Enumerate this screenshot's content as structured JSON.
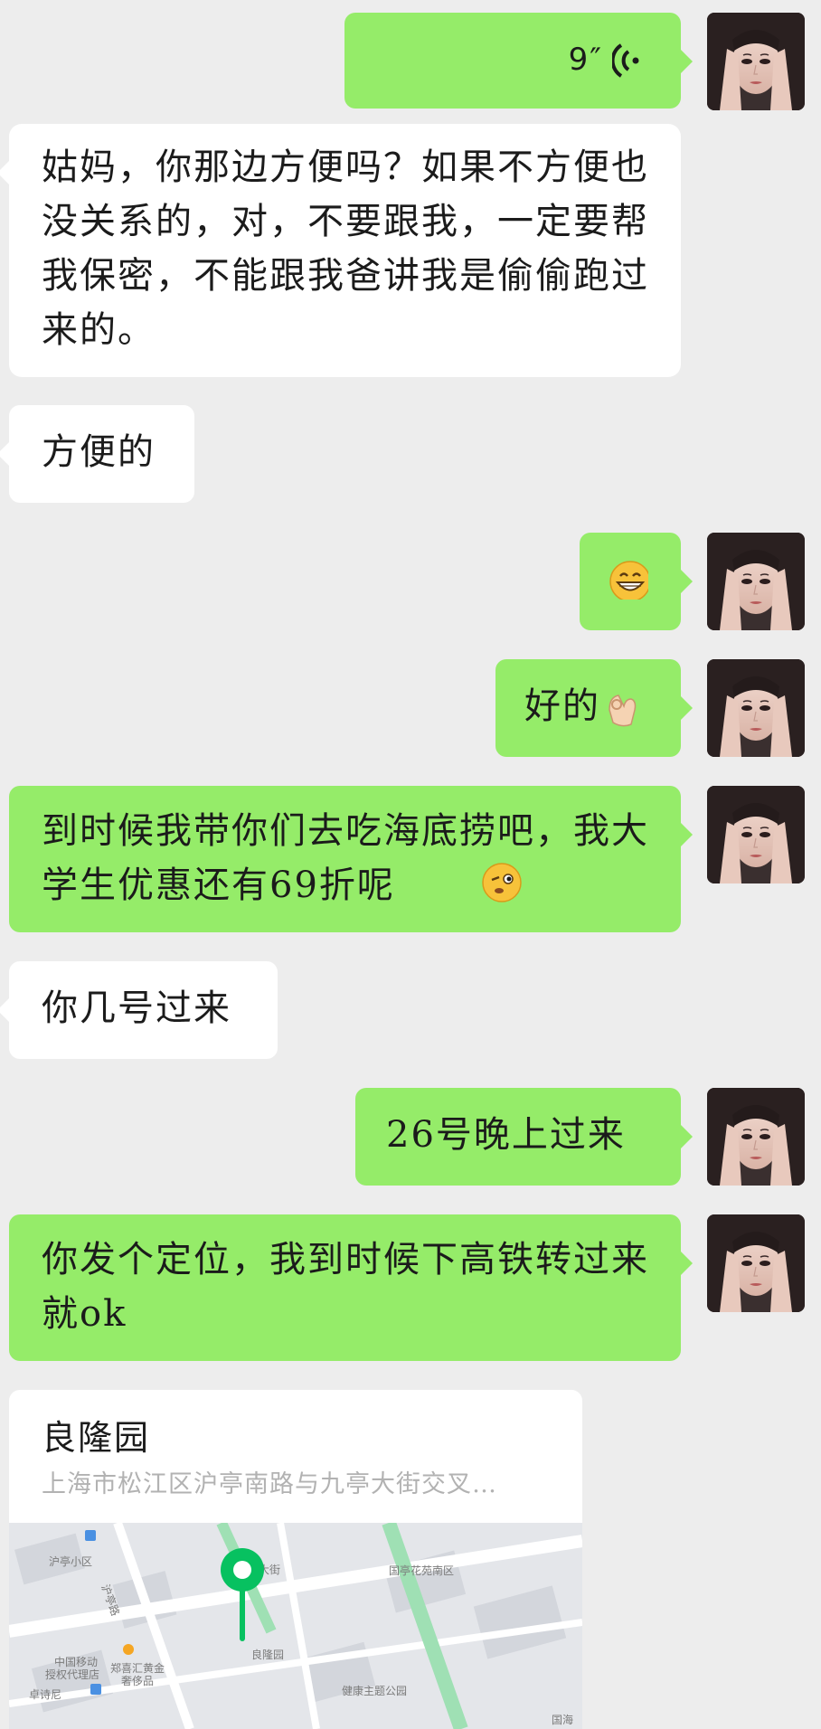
{
  "messages": {
    "voice_duration": "9″",
    "m1": "姑妈，你那边方便吗？如果不方便也没关系的，对，不要跟我，一定要帮我保密，不能跟我爸讲我是偷偷跑过来的。",
    "m2": "方便的",
    "m3_emoji": "grinning-face-emoji",
    "m4": "好的",
    "m4_emoji": "ok-hand-emoji",
    "m5": "到时候我带你们去吃海底捞吧，我大学生优惠还有69折呢",
    "m5_emoji": "winking-face-emoji",
    "m6": "你几号过来",
    "m7": "26号晚上过来",
    "m8": "你发个定位，我到时候下高铁转过来就ok"
  },
  "location": {
    "title": "良隆园",
    "address": "上海市松江区沪亭南路与九亭大街交叉…",
    "map_labels": {
      "area1": "沪亭小区",
      "road1": "沪亭路",
      "street": "大街",
      "area2": "国亭花苑南区",
      "poi1_line1": "中国移动",
      "poi1_line2": "授权代理店",
      "poi2_line1": "郑喜汇黄金",
      "poi2_line2": "奢侈品",
      "poi3": "良隆园",
      "park": "健康主题公园",
      "poi4": "卓诗尼",
      "edge": "国海"
    }
  },
  "colors": {
    "background": "#ededed",
    "outgoing_bubble": "#95ec69",
    "incoming_bubble": "#ffffff",
    "map_pin": "#07c160"
  }
}
